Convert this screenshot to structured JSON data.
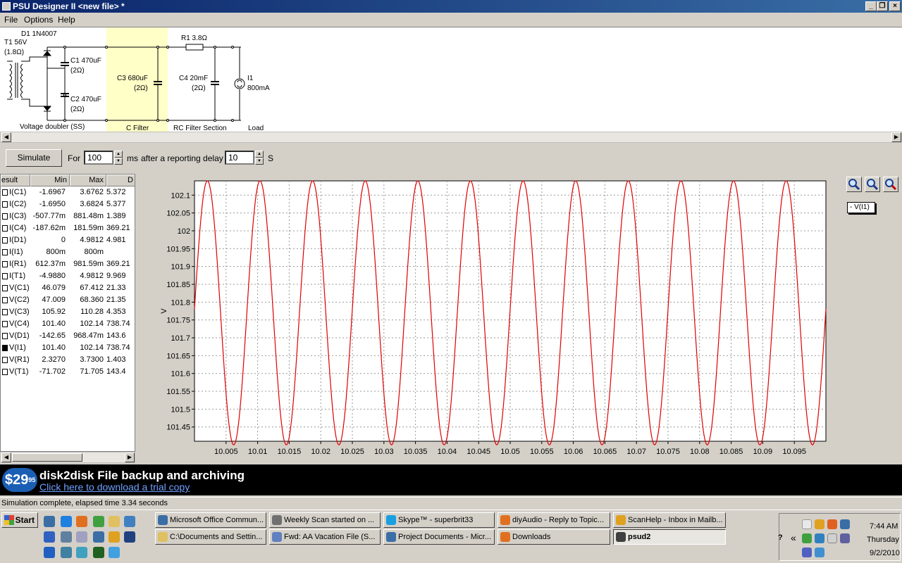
{
  "window": {
    "title": "PSU Designer II  <new file> *"
  },
  "menu": [
    "File",
    "Options",
    "Help"
  ],
  "schematic": {
    "t1_label": "T1 56V",
    "t1_res": "(1.8Ω)",
    "d1_label": "D1 1N4007",
    "c1_label": "C1 470uF",
    "c1_res": "(2Ω)",
    "c2_label": "C2 470uF",
    "c2_res": "(2Ω)",
    "c3_label": "C3 680uF",
    "c3_res": "(2Ω)",
    "r1_label": "R1 3.8Ω",
    "c4_label": "C4 20mF",
    "c4_res": "(2Ω)",
    "i1_label": "I1",
    "i1_value": "800mA",
    "sections": [
      "Voltage doubler (SS)",
      "C Filter",
      "RC Filter Section",
      "Load"
    ]
  },
  "controls": {
    "simulate_label": "Simulate",
    "for_label": "For",
    "duration_value": "100",
    "ms_label": "ms",
    "delay_label": "after a reporting delay of",
    "delay_value": "10",
    "s_label": "S"
  },
  "results": {
    "headers": [
      "esult",
      "Min",
      "Max",
      "D"
    ],
    "rows": [
      {
        "name": "I(C1)",
        "min": "-1.6967",
        "max": "3.6762",
        "d": "5.372",
        "checked": false
      },
      {
        "name": "I(C2)",
        "min": "-1.6950",
        "max": "3.6824",
        "d": "5.377",
        "checked": false
      },
      {
        "name": "I(C3)",
        "min": "-507.77m",
        "max": "881.48m",
        "d": "1.389",
        "checked": false
      },
      {
        "name": "I(C4)",
        "min": "-187.62m",
        "max": "181.59m",
        "d": "369.21",
        "checked": false
      },
      {
        "name": "I(D1)",
        "min": "0",
        "max": "4.9812",
        "d": "4.981",
        "checked": false
      },
      {
        "name": "I(I1)",
        "min": "800m",
        "max": "800m",
        "d": "",
        "checked": false
      },
      {
        "name": "I(R1)",
        "min": "612.37m",
        "max": "981.59m",
        "d": "369.21",
        "checked": false
      },
      {
        "name": "I(T1)",
        "min": "-4.9880",
        "max": "4.9812",
        "d": "9.969",
        "checked": false
      },
      {
        "name": "V(C1)",
        "min": "46.079",
        "max": "67.412",
        "d": "21.33",
        "checked": false
      },
      {
        "name": "V(C2)",
        "min": "47.009",
        "max": "68.360",
        "d": "21.35",
        "checked": false
      },
      {
        "name": "V(C3)",
        "min": "105.92",
        "max": "110.28",
        "d": "4.353",
        "checked": false
      },
      {
        "name": "V(C4)",
        "min": "101.40",
        "max": "102.14",
        "d": "738.74",
        "checked": false
      },
      {
        "name": "V(D1)",
        "min": "-142.65",
        "max": "968.47m",
        "d": "143.6",
        "checked": false
      },
      {
        "name": "V(I1)",
        "min": "101.40",
        "max": "102.14",
        "d": "738.74",
        "checked": true
      },
      {
        "name": "V(R1)",
        "min": "2.3270",
        "max": "3.7300",
        "d": "1.403",
        "checked": false
      },
      {
        "name": "V(T1)",
        "min": "-71.702",
        "max": "71.705",
        "d": "143.4",
        "checked": false
      }
    ]
  },
  "chart_data": {
    "type": "line",
    "ylabel": "V",
    "xlim": [
      10.0,
      10.1
    ],
    "ylim": [
      101.41,
      102.14
    ],
    "yticks": [
      "102.1",
      "102.05",
      "102",
      "101.95",
      "101.9",
      "101.85",
      "101.8",
      "101.75",
      "101.7",
      "101.65",
      "101.6",
      "101.55",
      "101.5",
      "101.45"
    ],
    "ytick_values": [
      102.1,
      102.05,
      102.0,
      101.95,
      101.9,
      101.85,
      101.8,
      101.75,
      101.7,
      101.65,
      101.6,
      101.55,
      101.5,
      101.45
    ],
    "xticks": [
      "10.005",
      "10.01",
      "10.015",
      "10.02",
      "10.025",
      "10.03",
      "10.035",
      "10.04",
      "10.045",
      "10.05",
      "10.055",
      "10.06",
      "10.065",
      "10.07",
      "10.075",
      "10.08",
      "10.085",
      "10.09",
      "10.095"
    ],
    "xtick_values": [
      10.005,
      10.01,
      10.015,
      10.02,
      10.025,
      10.03,
      10.035,
      10.04,
      10.045,
      10.05,
      10.055,
      10.06,
      10.065,
      10.07,
      10.075,
      10.08,
      10.085,
      10.09,
      10.095
    ],
    "series": [
      {
        "name": "V(I1)",
        "color": "#e00000",
        "offset": 101.77,
        "amplitude": 0.37,
        "frequency_hz": 120,
        "phase_x": 10.0
      }
    ],
    "grid": true,
    "legend": "top-right",
    "legend_label": "- V(I1)"
  },
  "banner": {
    "price": "$29",
    "cents": "95",
    "title": "disk2disk File backup and archiving",
    "link": "Click here to download a trial copy"
  },
  "status": "Simulation complete, elapsed time 3.34 seconds",
  "taskbar": {
    "start_label": "Start",
    "row1": [
      {
        "label": "Microsoft Office Commun...",
        "color": "#3a6ea5"
      },
      {
        "label": "Weekly Scan started on ...",
        "color": "#707070"
      },
      {
        "label": "Skype™ - superbrit33",
        "color": "#1a9fe0"
      },
      {
        "label": "diyAudio - Reply to Topic...",
        "color": "#e07020"
      },
      {
        "label": "ScanHelp - Inbox in Mailb...",
        "color": "#e0a020"
      }
    ],
    "row2": [
      {
        "label": "C:\\Documents and Settin...",
        "color": "#e0c060"
      },
      {
        "label": "Fwd: AA Vacation File (S...",
        "color": "#6080c0"
      },
      {
        "label": "Project Documents - Micr...",
        "color": "#3a6ea5"
      },
      {
        "label": "Downloads",
        "color": "#e07020"
      },
      {
        "label": "psud2",
        "color": "#404040"
      }
    ],
    "clock": {
      "time": "7:44 AM",
      "day": "Thursday",
      "date": "9/2/2010"
    },
    "help": "?",
    "chevron": "«"
  }
}
